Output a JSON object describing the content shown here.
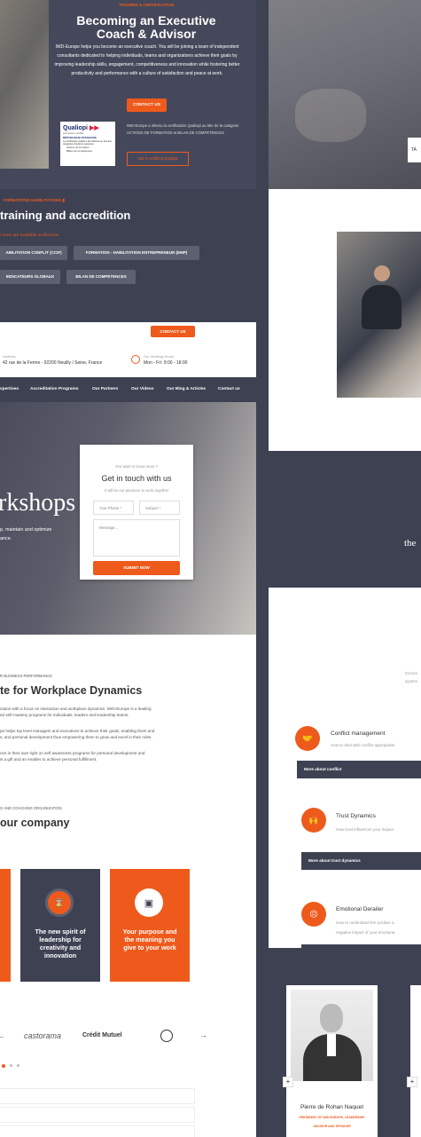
{
  "hero": {
    "eyebrow": "TRAINING & CERTIFICATION",
    "title_line1": "Becoming an Executive",
    "title_line2": "Coach & Advisor",
    "body": "IWD-Europe helps you become an executive coach. You will be joining a team of independent consultants dedicated to helping individuals, teams and organizations achieve their goals by improving leadership skills, engagement, competitiveness and innovation while fostering better productivity and performance with a culture of satisfaction and peace at work.",
    "cta": "CONTACT US",
    "qualiopi_brand": "Qualiopi",
    "qualiopi_sub": "processus certifié",
    "qualiopi_republic": "RÉPUBLIQUE FRANÇAISE",
    "qualiopi_note": "La certification qualité a été délivrée au titre des catégories d'actions suivantes :",
    "qualiopi_item1": "Actions de formation",
    "qualiopi_item2": "Bilans de compétences",
    "qualiopi_text": "IWD-Europe a obtenu la certification Qualiopi au titre de la catégorie ACTIONS DE FORMATION et BILAN DE COMPÉTENCES",
    "qualiopi_btn": "Voir le certificat Qualiopi"
  },
  "training": {
    "eyebrow": "FORMATIONS HABILITATIONS",
    "title": "training and accredition",
    "subtitle": "t ones are available at this time",
    "pills": [
      "ABILITATION CONFLIT (CCIF)",
      "FORMATION - HABILITATION ENTREPRENEUR (EMP)",
      "INDICATEURS GLOBAUX",
      "BILAN DE COMPETENCES"
    ]
  },
  "header": {
    "contact_btn": "CONTACT US",
    "address_label": "Address",
    "address_value": "42 rue de la Ferme - 92200 Neuilly / Seine, France",
    "hours_label": "Our Working Hours",
    "hours_value": "Mon - Fri: 9:00 - 18:00",
    "nav": [
      "xpertises",
      "Accreditation Programs",
      "Our Partners",
      "Our Videos",
      "Our Blog & Articles",
      "Contact us"
    ]
  },
  "hero2": {
    "big_word": "rkshops",
    "text_line1": "p, maintain and optimize",
    "text_line2": "ance."
  },
  "form": {
    "eyebrow": "You want to know more ?",
    "title": "Get in touch with us",
    "sub": "It will be our pleasure to work together",
    "phone_placeholder": "Your Phone *",
    "subject_placeholder": "Subject *",
    "message_placeholder": "Message...",
    "submit": "SUBMIT NOW"
  },
  "about": {
    "eyebrow": "R BUSINESS PERFORMANCE",
    "title": "te for Workplace Dynamics",
    "p1": "zation with a focus on interaction and workplace dynamics. IWD-Europe is a leading",
    "p1b": "ed self-mastery programs for individuals, leaders and leadership teams.",
    "p2": "pe helps top level managers and executives to achieve their goals, enabling them and",
    "p2b": "s, and personal development thus empowering them to grow and excel in their roles.",
    "p3": "ons in their own right on self awareness programs for personal development and",
    "p3b": "is a gift and an enabler to achieve personal fulfillment.",
    "eyebrow2": "G AND COACHING ORGANIZATION",
    "title2": "our company"
  },
  "cards": [
    {
      "label": "The new spirit of leadership for creativity and innovation",
      "icon": "hourglass-icon"
    },
    {
      "label": "Your purpose and the meaning you give to your work",
      "icon": "briefcase-icon"
    }
  ],
  "logos": [
    "castorama",
    "Crédit Mutuel"
  ],
  "topics": [
    {
      "title": "Conflict management",
      "sub": "How to deal with conflict appropriate",
      "bar": "More about conflict",
      "icon": "handshake-icon"
    },
    {
      "title": "Trust Dynamics",
      "sub": "How trust influences your impact",
      "bar": "More about trust dynamics",
      "icon": "hands-icon"
    },
    {
      "title": "Emotional Derailer",
      "sub": "How to understand the positive a",
      "sub2": "negative impact of your emotiona",
      "icon": "face-icon"
    }
  ],
  "right_panel": {
    "tab_label": "TA",
    "quote_word": "the",
    "small_text1": "Circum",
    "small_text2": "system"
  },
  "person": {
    "name": "Pierre de Rohan Naquet",
    "role_line1": "PRESIDENT OF IWD EUROPE, LEADERSHIP",
    "role_line2": "ADVISOR AND SPEAKER"
  },
  "colors": {
    "accent": "#ee5a1c",
    "dark": "#3e4152"
  }
}
